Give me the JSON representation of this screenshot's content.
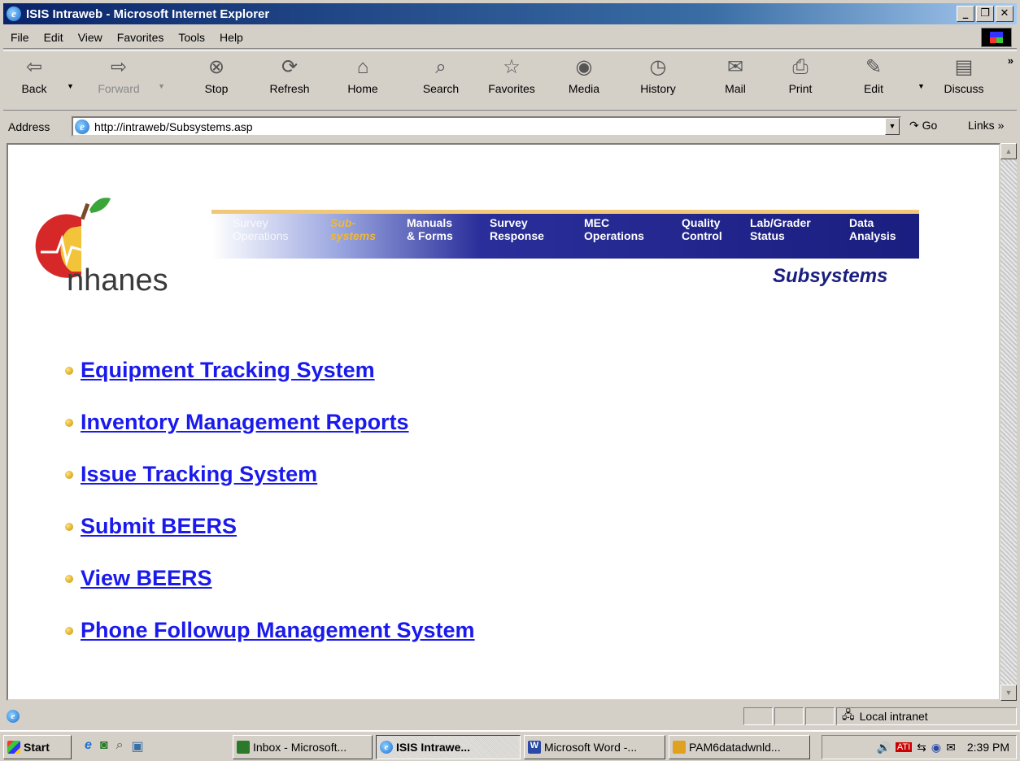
{
  "window": {
    "title": "ISIS Intraweb - Microsoft Internet Explorer"
  },
  "menu": [
    "File",
    "Edit",
    "View",
    "Favorites",
    "Tools",
    "Help"
  ],
  "toolbar": {
    "back": "Back",
    "forward": "Forward",
    "stop": "Stop",
    "refresh": "Refresh",
    "home": "Home",
    "search": "Search",
    "favorites": "Favorites",
    "media": "Media",
    "history": "History",
    "mail": "Mail",
    "print": "Print",
    "edit": "Edit",
    "discuss": "Discuss"
  },
  "address": {
    "label": "Address",
    "url": "http://intraweb/Subsystems.asp",
    "go": "Go",
    "links": "Links"
  },
  "page": {
    "brand": "nhanes",
    "section_title": "Subsystems",
    "nav": [
      {
        "line1": "Survey",
        "line2": "Operations"
      },
      {
        "line1": "Sub-",
        "line2": "systems"
      },
      {
        "line1": "Manuals",
        "line2": "& Forms"
      },
      {
        "line1": "Survey",
        "line2": "Response"
      },
      {
        "line1": "MEC",
        "line2": "Operations"
      },
      {
        "line1": "Quality",
        "line2": "Control"
      },
      {
        "line1": "Lab/Grader",
        "line2": "Status"
      },
      {
        "line1": "Data",
        "line2": "Analysis"
      }
    ],
    "links": [
      "Equipment Tracking System",
      "Inventory Management Reports",
      "Issue Tracking System",
      "Submit BEERS",
      "View BEERS",
      "Phone Followup Management System"
    ]
  },
  "status": {
    "zone": "Local intranet"
  },
  "taskbar": {
    "start": "Start",
    "buttons": [
      "Inbox - Microsoft...",
      "ISIS Intrawe...",
      "Microsoft Word -...",
      "PAM6datadwnld..."
    ],
    "clock": "2:39 PM"
  },
  "colors": {
    "link": "#1a1aee",
    "nav_band": "#1a1e7f",
    "current_nav": "#f0b838",
    "titlebar": "#0a246a"
  }
}
